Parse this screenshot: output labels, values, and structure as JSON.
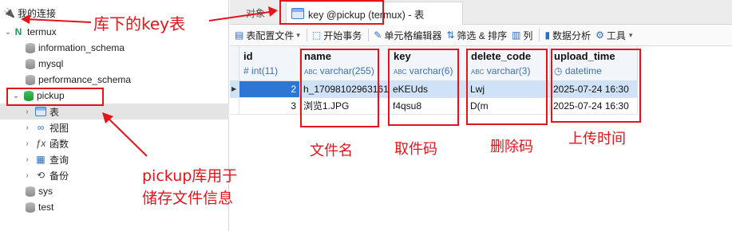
{
  "sidebar": {
    "connections_label": "我的连接",
    "connection": "termux",
    "databases": [
      "information_schema",
      "mysql",
      "performance_schema"
    ],
    "active_db": "pickup",
    "sub_items": [
      "表",
      "视图",
      "函数",
      "查询",
      "备份"
    ],
    "more_dbs": [
      "sys",
      "test"
    ]
  },
  "tabs": {
    "objects_label": "对象",
    "active_label": "key @pickup (termux) - 表"
  },
  "toolbar": {
    "items": [
      "表配置文件",
      "开始事务",
      "单元格编辑器",
      "筛选 & 排序",
      "列",
      "数据分析",
      "工具"
    ]
  },
  "grid": {
    "columns": [
      {
        "name": "id",
        "type": "int(11)"
      },
      {
        "name": "name",
        "type": "varchar(255)"
      },
      {
        "name": "key",
        "type": "varchar(6)"
      },
      {
        "name": "delete_code",
        "type": "varchar(3)"
      },
      {
        "name": "upload_time",
        "type": "datetime"
      }
    ],
    "rows": [
      [
        "2",
        "h_17098102963161",
        "eKEUds",
        "Lwj",
        "2025-07-24 16:30"
      ],
      [
        "3",
        "浏览1.JPG",
        "f4qsu8",
        "D(m",
        "2025-07-24 16:30"
      ]
    ]
  },
  "annotations": {
    "tables_note": "库下的key表",
    "pickup_note_line1": "pickup库用于",
    "pickup_note_line2": "储存文件信息",
    "filename": "文件名",
    "fetch_code": "取件码",
    "delete_code": "删除码",
    "upload_time": "上传时间"
  },
  "colors": {
    "annotation": "#e3141b",
    "selection": "#cfe2f7",
    "accent": "#2b6cc4"
  }
}
